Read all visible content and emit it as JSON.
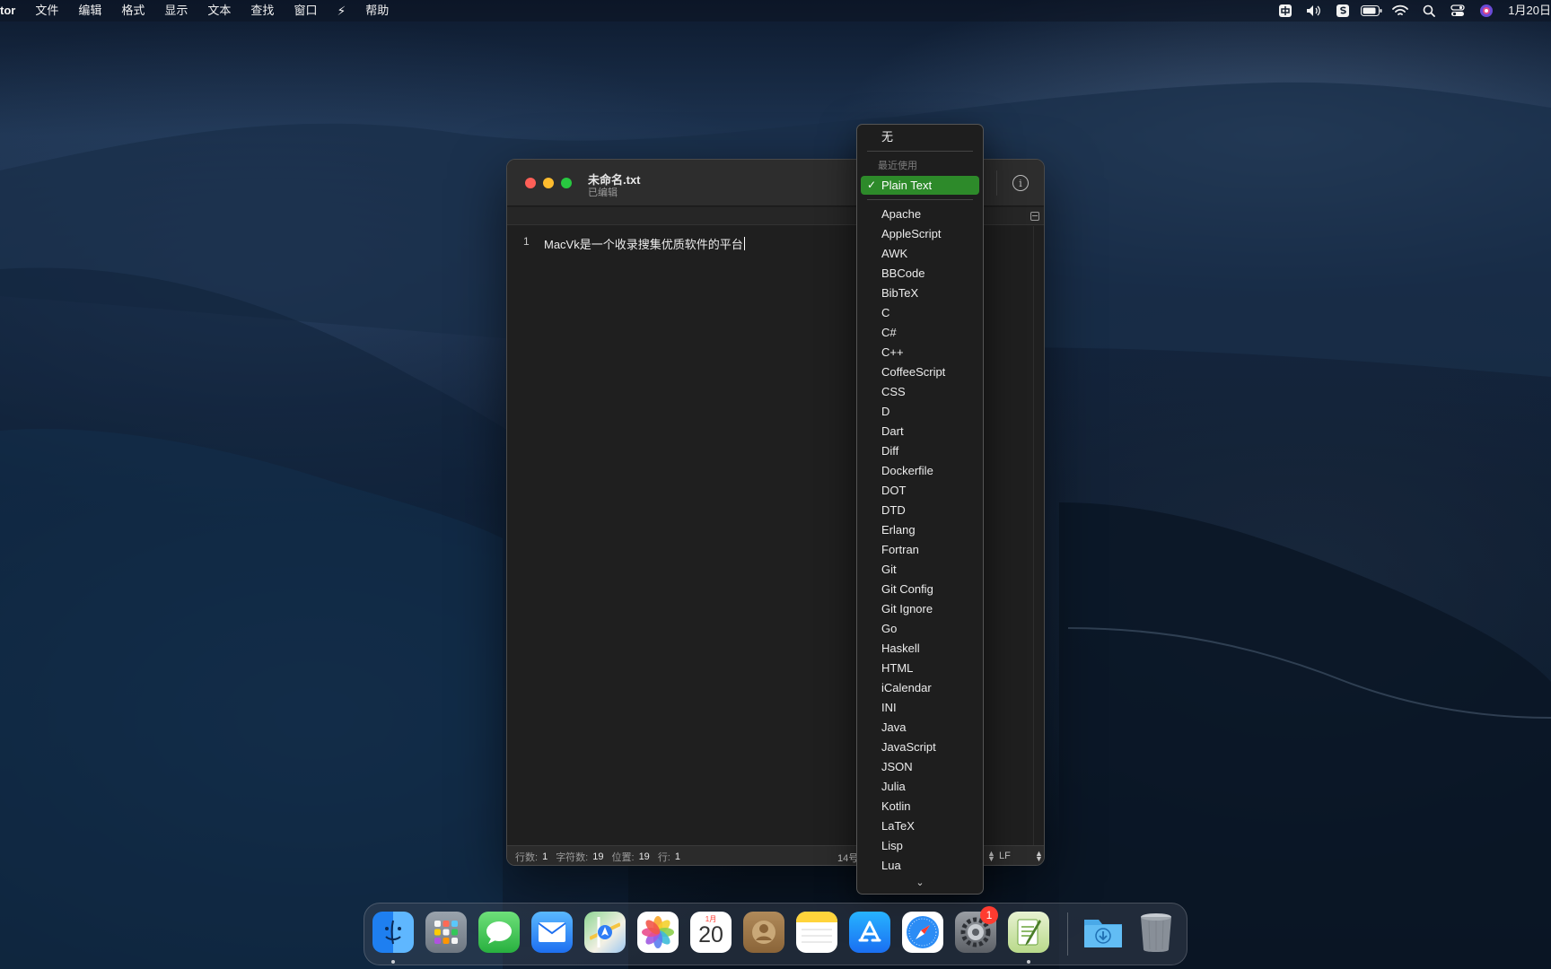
{
  "menubar": {
    "app_name": "tor",
    "items": [
      "文件",
      "编辑",
      "格式",
      "显示",
      "文本",
      "查找",
      "窗口",
      "帮助"
    ],
    "clock": "1月20日"
  },
  "window": {
    "title": "未命名.txt",
    "subtitle": "已编辑",
    "lines": [
      {
        "number": "1",
        "text": "MacVk是一个收录搜集优质软件的平台"
      }
    ],
    "status": {
      "lines_label": "行数:",
      "lines_value": "1",
      "chars_label": "字符数:",
      "chars_value": "19",
      "position_label": "位置:",
      "position_value": "19",
      "row_label": "行:",
      "row_value": "1",
      "font_size": "14号",
      "line_ending": "LF"
    }
  },
  "syntax_menu": {
    "none_label": "无",
    "recent_header": "最近使用",
    "selected": "Plain Text",
    "items": [
      "Apache",
      "AppleScript",
      "AWK",
      "BBCode",
      "BibTeX",
      "C",
      "C#",
      "C++",
      "CoffeeScript",
      "CSS",
      "D",
      "Dart",
      "Diff",
      "Dockerfile",
      "DOT",
      "DTD",
      "Erlang",
      "Fortran",
      "Git",
      "Git Config",
      "Git Ignore",
      "Go",
      "Haskell",
      "HTML",
      "iCalendar",
      "INI",
      "Java",
      "JavaScript",
      "JSON",
      "Julia",
      "Kotlin",
      "LaTeX",
      "Lisp",
      "Lua"
    ]
  },
  "dock": {
    "calendar_month": "1月",
    "calendar_day": "20",
    "settings_badge": "1"
  }
}
